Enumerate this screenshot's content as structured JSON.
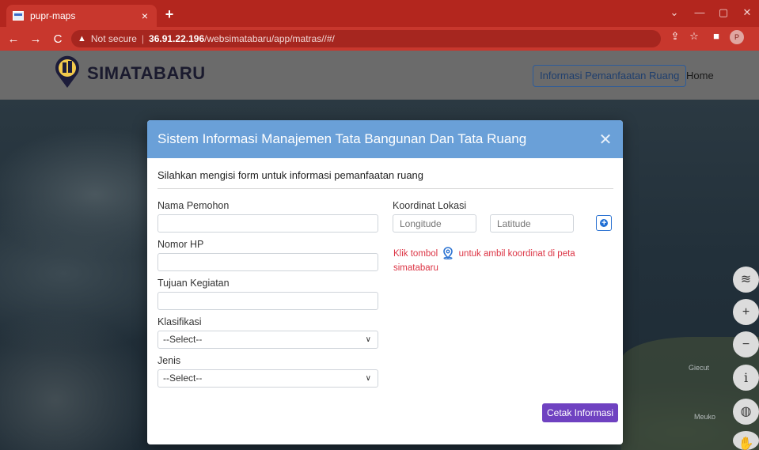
{
  "browser": {
    "tab_title": "pupr-maps",
    "tab_close": "×",
    "new_tab": "+",
    "window_controls": [
      "⌄",
      "—",
      "▢",
      "✕"
    ],
    "nav": [
      "←",
      "→",
      "C"
    ],
    "security_label": "Not secure",
    "url_host": "36.91.22.196",
    "url_path": "/websimatabaru/app/matras//#/",
    "toolbar_icons": [
      "share-icon",
      "star-icon",
      "sidebar-icon"
    ],
    "profile_initial": "P"
  },
  "app": {
    "logo_text": "SIMATABARU",
    "nav_button": "Informasi Pemanfaatan Ruang",
    "nav_home": "Home"
  },
  "map": {
    "labels": [
      "Giecut",
      "Meuko"
    ],
    "controls": [
      "layers-icon",
      "zoom-in-icon",
      "zoom-out-icon",
      "info-icon",
      "globe-icon",
      "hand-icon"
    ]
  },
  "modal": {
    "title": "Sistem Informasi Manajemen Tata Bangunan Dan Tata Ruang",
    "close": "✕",
    "subtitle": "Silahkan mengisi form untuk informasi pemanfaatan ruang",
    "fields": {
      "nama_label": "Nama Pemohon",
      "hp_label": "Nomor HP",
      "tujuan_label": "Tujuan Kegiatan",
      "klasifikasi_label": "Klasifikasi",
      "klasifikasi_value": "--Select--",
      "jenis_label": "Jenis",
      "jenis_value": "--Select--",
      "koordinat_label": "Koordinat Lokasi",
      "longitude_placeholder": "Longitude",
      "latitude_placeholder": "Latitude"
    },
    "hint_before": "Klik tombol",
    "hint_after": "untuk ambil koordinat di peta simatabaru",
    "submit": "Cetak Informasi"
  }
}
